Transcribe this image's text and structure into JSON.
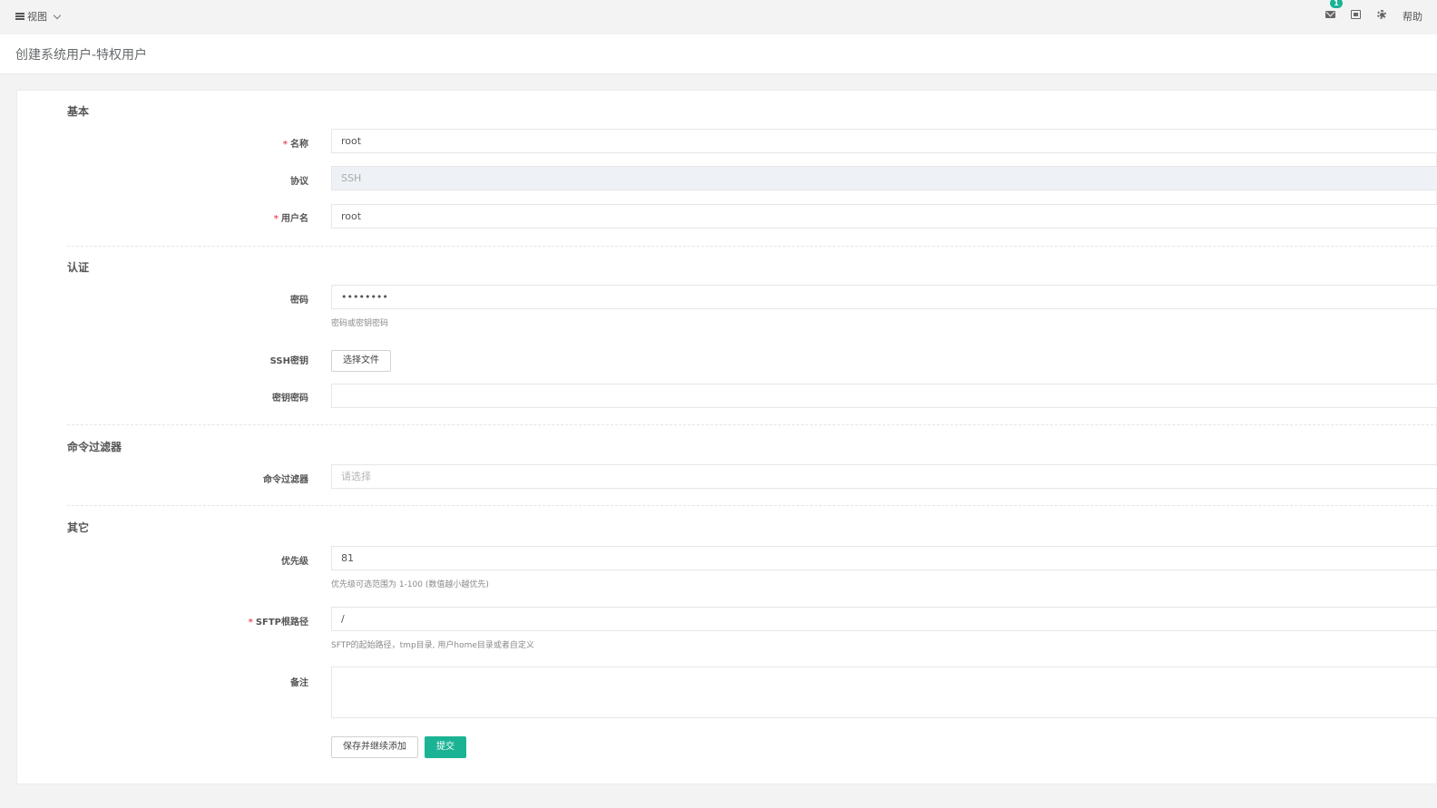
{
  "topbar": {
    "view_label": "视图",
    "notification_count": "1",
    "help_label": "帮助"
  },
  "page": {
    "title": "创建系统用户-特权用户"
  },
  "sections": {
    "basic": "基本",
    "auth": "认证",
    "command_filter": "命令过滤器",
    "other": "其它"
  },
  "fields": {
    "name": {
      "label": "名称",
      "value": "root",
      "required": "*"
    },
    "protocol": {
      "label": "协议",
      "value": "SSH"
    },
    "username": {
      "label": "用户名",
      "value": "root",
      "required": "*"
    },
    "password": {
      "label": "密码",
      "value": "••••••••",
      "help": "密码或密钥密码"
    },
    "ssh_key": {
      "label": "SSH密钥",
      "button": "选择文件"
    },
    "key_password": {
      "label": "密钥密码",
      "value": ""
    },
    "cmd_filter": {
      "label": "命令过滤器",
      "placeholder": "请选择"
    },
    "priority": {
      "label": "优先级",
      "value": "81",
      "help": "优先级可选范围为 1-100 (数值越小越优先)"
    },
    "sftp_root": {
      "label": "SFTP根路径",
      "value": "/",
      "required": "*",
      "help": "SFTP的起始路径，tmp目录, 用户home目录或者自定义"
    },
    "comment": {
      "label": "备注",
      "value": ""
    }
  },
  "actions": {
    "save_continue": "保存并继续添加",
    "submit": "提交"
  },
  "colors": {
    "accent": "#1ab394",
    "required": "#ed5565"
  }
}
